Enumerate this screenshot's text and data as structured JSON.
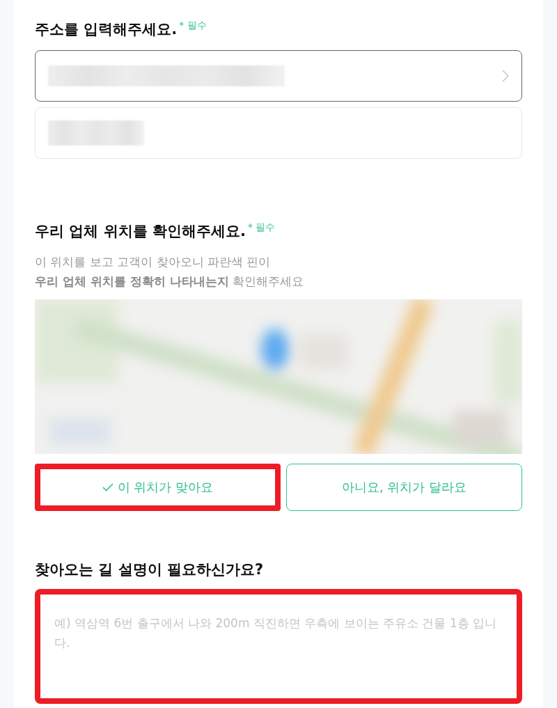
{
  "address_section": {
    "title": "주소를 입력해주세요.",
    "required_mark": "*",
    "required_label": "필수",
    "fields": [
      {
        "kind": "select",
        "redacted": true
      },
      {
        "kind": "text",
        "redacted": true
      }
    ]
  },
  "location_section": {
    "title": "우리 업체 위치를 확인해주세요.",
    "required_mark": "*",
    "required_label": "필수",
    "description": [
      "이 위치를 보고 고객이 찾아오니 파란색 핀이",
      "**우리 업체 위치를 정확히 나타내는지** 확인해주세요"
    ],
    "choices": [
      {
        "label": "이 위치가 맞아요",
        "selected": true,
        "highlighted": true
      },
      {
        "label": "아니요, 위치가 달라요",
        "selected": false,
        "highlighted": false
      }
    ]
  },
  "directions_section": {
    "title": "찾아오는 길 설명이 필요하신가요?",
    "field": {
      "placeholder": "예) 역삼역 6번 출구에서 나와 200m 직진하면 우측에 보이는 주유소 건물 1층 입니다.",
      "highlighted": true
    }
  }
}
